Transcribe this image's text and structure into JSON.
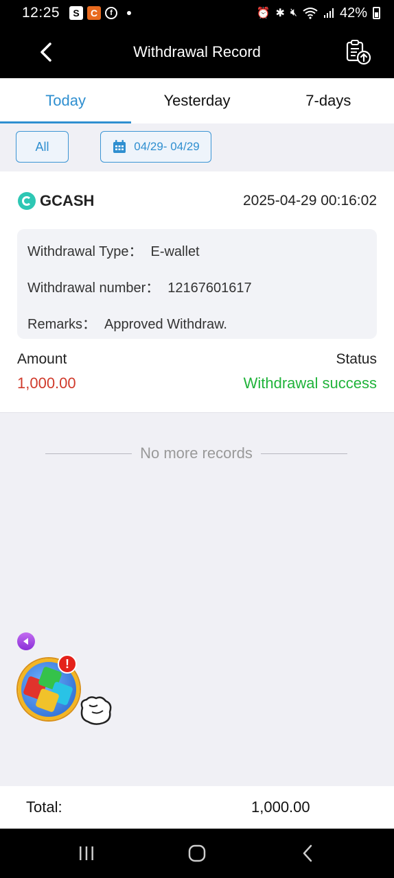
{
  "status_bar": {
    "time": "12:25",
    "app_icons": [
      "S",
      "C",
      "f"
    ],
    "battery": "42%"
  },
  "app_bar": {
    "title": "Withdrawal Record"
  },
  "tabs": [
    {
      "label": "Today",
      "active": true
    },
    {
      "label": "Yesterday",
      "active": false
    },
    {
      "label": "7-days",
      "active": false
    }
  ],
  "filters": {
    "all_label": "All",
    "date_range": "04/29- 04/29"
  },
  "record": {
    "method": "GCASH",
    "datetime": "2025-04-29 00:16:02",
    "details": [
      {
        "label": "Withdrawal Type：",
        "value": "E-wallet"
      },
      {
        "label": "Withdrawal number：",
        "value": "12167601617"
      },
      {
        "label": "Remarks：",
        "value": "Approved Withdraw."
      }
    ],
    "amount_label": "Amount",
    "amount": "1,000.00",
    "status_label": "Status",
    "status": "Withdrawal success"
  },
  "list_end": "No more records",
  "widget": {
    "badge": "!"
  },
  "total": {
    "label": "Total:",
    "value": "1,000.00"
  },
  "colors": {
    "accent": "#2f8fd0",
    "amount": "#d03a2b",
    "success": "#20b33a",
    "gcash": "#2ec7b4"
  }
}
